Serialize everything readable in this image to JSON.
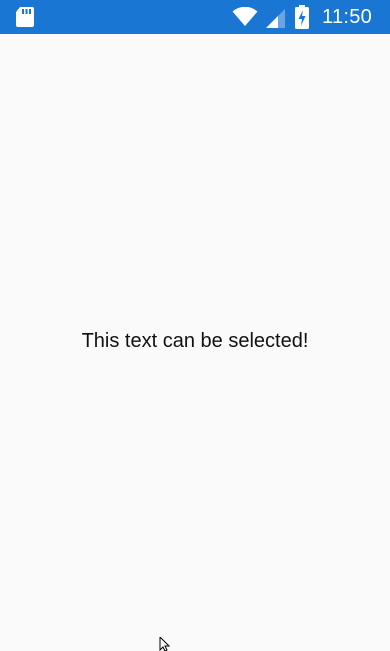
{
  "status_bar": {
    "time": "11:50",
    "background_color": "#1976d2",
    "icons": [
      "sd-card-icon",
      "wifi-icon",
      "cellular-signal-icon",
      "battery-charging-icon"
    ]
  },
  "main": {
    "message": "This text can be selected!"
  },
  "colors": {
    "page_background": "#fafafa",
    "text": "#111111"
  }
}
